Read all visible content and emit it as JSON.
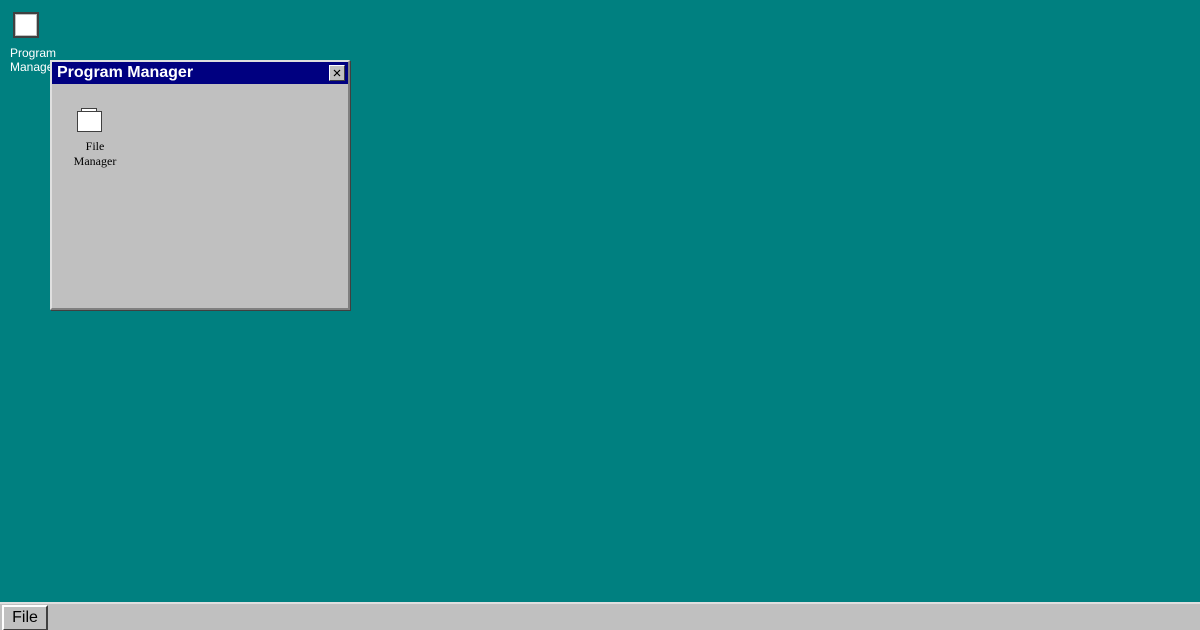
{
  "desktop": {
    "background_color": "#008080",
    "icons": [
      {
        "label": "Program Manager",
        "icon": "program-manager-icon"
      }
    ]
  },
  "window": {
    "title": "Program Manager",
    "title_bar_color": "#000080",
    "close_icon": "close-icon",
    "programs": [
      {
        "label": "File Manager",
        "icon": "file-manager-icon"
      }
    ]
  },
  "taskbar": {
    "button_label": "File"
  }
}
